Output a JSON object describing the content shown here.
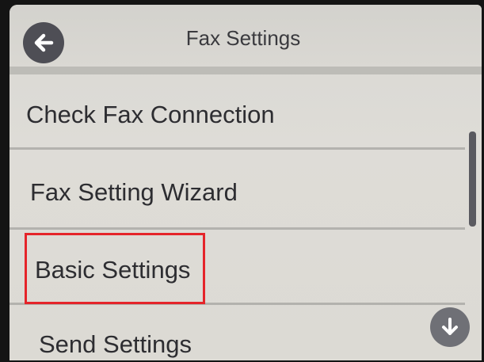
{
  "header": {
    "title": "Fax Settings",
    "back_icon": "arrow-left-icon"
  },
  "menu": {
    "items": [
      {
        "label": "Check Fax Connection"
      },
      {
        "label": "Fax Setting Wizard"
      },
      {
        "label": "Basic Settings",
        "highlighted": true
      },
      {
        "label": "Send Settings"
      }
    ]
  },
  "scroll": {
    "down_icon": "arrow-down-icon"
  },
  "colors": {
    "screen_bg": "#dcdad4",
    "text": "#2d2d31",
    "icon_button": "#4e4e55",
    "highlight": "#e5242a"
  }
}
